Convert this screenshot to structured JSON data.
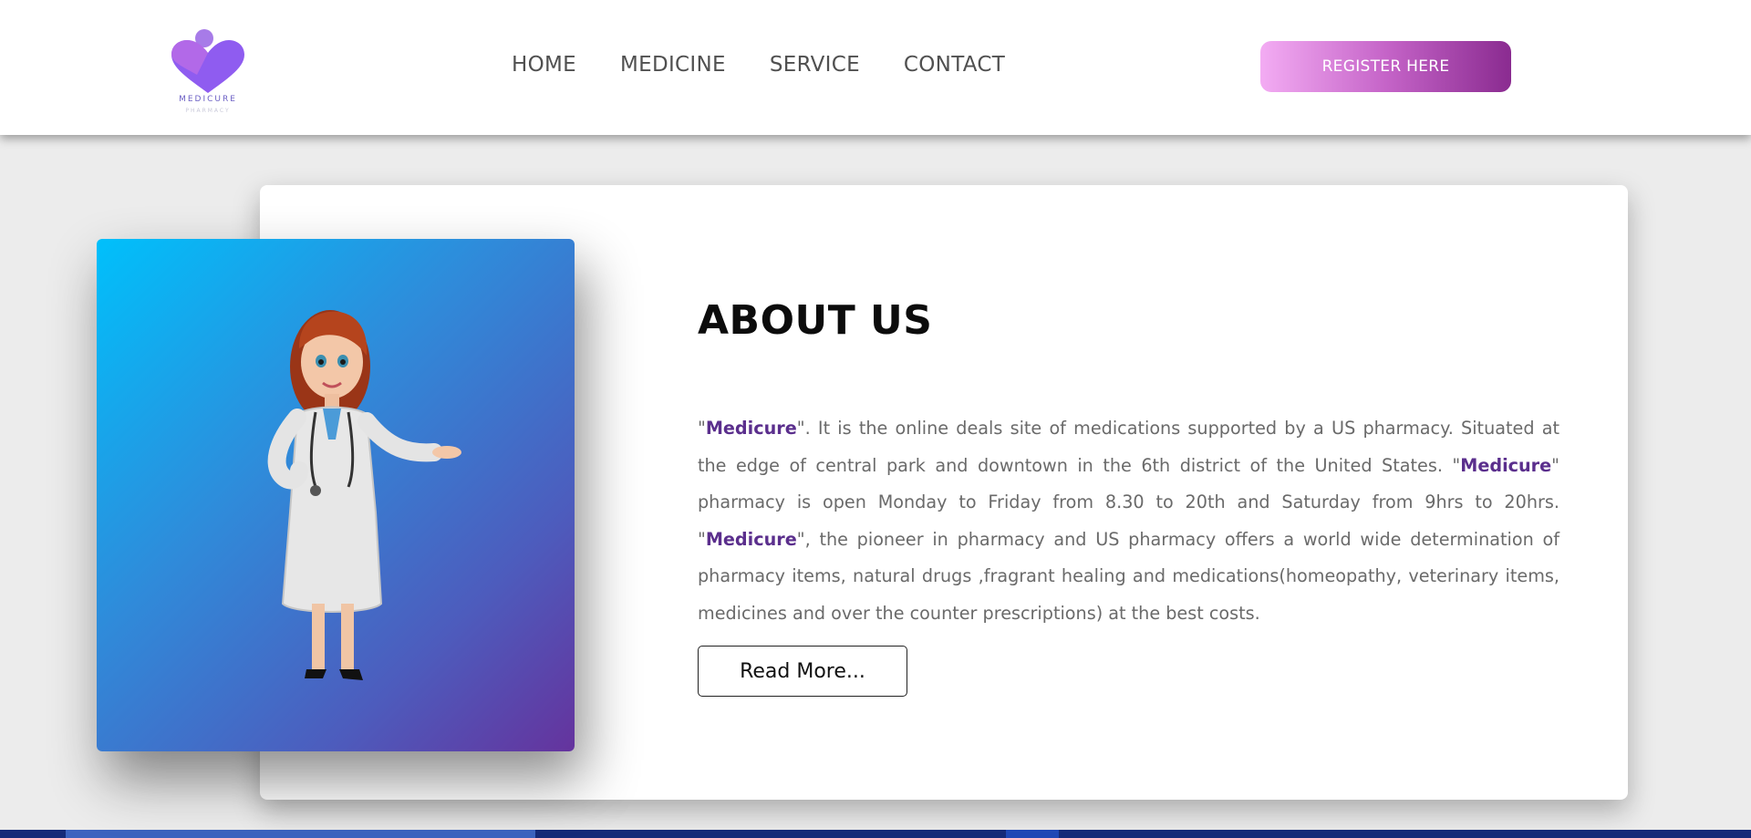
{
  "brand": {
    "logo_text": "MEDICURE",
    "logo_subtext": "PHARMACY"
  },
  "nav": {
    "items": [
      {
        "label": "HOME"
      },
      {
        "label": "MEDICINE"
      },
      {
        "label": "SERVICE"
      },
      {
        "label": "CONTACT"
      }
    ]
  },
  "header": {
    "register_label": "REGISTER HERE"
  },
  "about": {
    "title": "ABOUT US",
    "brand_name": "Medicure",
    "para_q1": "\"",
    "para_part1": "\". It is the online deals site of medications supported by a US pharmacy. Situated at the edge of central park and downtown in the 6th district of the United States. \"",
    "para_part2": "\" pharmacy is open Monday to Friday from 8.30 to 20th and Saturday from 9hrs to 20hrs. \"",
    "para_part3": "\", the pioneer in pharmacy and US pharmacy offers a world wide determination of pharmacy items, natural drugs ,fragrant healing and medications(homeopathy, veterinary items, medicines and over the counter prescriptions) at the best costs.",
    "read_more_label": "Read More..."
  },
  "colors": {
    "brand_purple": "#5b2f8d",
    "register_gradient_start": "#f3acf3",
    "register_gradient_end": "#8a2b90",
    "image_gradient_start": "#00c0fb",
    "image_gradient_end": "#65339d"
  },
  "icons": {
    "logo": "heart-people-logo-icon",
    "illustration": "doctor-illustration"
  }
}
